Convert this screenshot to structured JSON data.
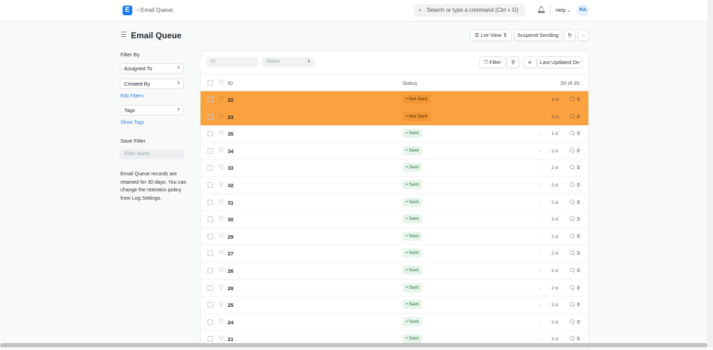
{
  "nav": {
    "logo": "E",
    "breadcrumb": "Email Queue",
    "search_placeholder": "Search or type a command (Ctrl + G)",
    "help": "Help",
    "avatar": "RA"
  },
  "page": {
    "title": "Email Queue",
    "list_view": "List View",
    "suspend": "Suspend Sending",
    "refresh": "↻",
    "more": "···"
  },
  "sidebar": {
    "filter_by": "Filter By",
    "assigned_to": "Assigned To",
    "created_by": "Created By",
    "edit_filters": "Edit Filters",
    "tags": "Tags",
    "show_tags": "Show Tags",
    "save_filter": "Save Filter",
    "filter_name_placeholder": "Filter Name",
    "note": "Email Queue records are retained for 30 days. You can change the retention policy from Log Settings."
  },
  "toolbar": {
    "id_placeholder": "ID",
    "status_placeholder": "Status",
    "filter": "Filter",
    "sort": "Last Updated On"
  },
  "table": {
    "col_id": "ID",
    "col_status": "Status",
    "count": "20 of 35",
    "rows": [
      {
        "id": "22",
        "status": "Not Sent",
        "time": "4 m",
        "comments": "0",
        "highlight": true
      },
      {
        "id": "23",
        "status": "Not Sent",
        "time": "4 m",
        "comments": "0",
        "highlight": true
      },
      {
        "id": "35",
        "status": "Sent",
        "time": "1 d",
        "comments": "0"
      },
      {
        "id": "34",
        "status": "Sent",
        "time": "2 d",
        "comments": "0"
      },
      {
        "id": "33",
        "status": "Sent",
        "time": "2 d",
        "comments": "0"
      },
      {
        "id": "32",
        "status": "Sent",
        "time": "2 d",
        "comments": "0"
      },
      {
        "id": "31",
        "status": "Sent",
        "time": "2 d",
        "comments": "0"
      },
      {
        "id": "30",
        "status": "Sent",
        "time": "2 d",
        "comments": "0"
      },
      {
        "id": "29",
        "status": "Sent",
        "time": "2 d",
        "comments": "0"
      },
      {
        "id": "27",
        "status": "Sent",
        "time": "2 d",
        "comments": "0"
      },
      {
        "id": "26",
        "status": "Sent",
        "time": "2 d",
        "comments": "0"
      },
      {
        "id": "28",
        "status": "Sent",
        "time": "2 d",
        "comments": "0"
      },
      {
        "id": "25",
        "status": "Sent",
        "time": "2 d",
        "comments": "0"
      },
      {
        "id": "24",
        "status": "Sent",
        "time": "2 d",
        "comments": "0"
      },
      {
        "id": "21",
        "status": "Sent",
        "time": "2 d",
        "comments": "0"
      }
    ]
  },
  "colors": {
    "highlight": "#fba240",
    "brand": "#1a7cf5"
  }
}
